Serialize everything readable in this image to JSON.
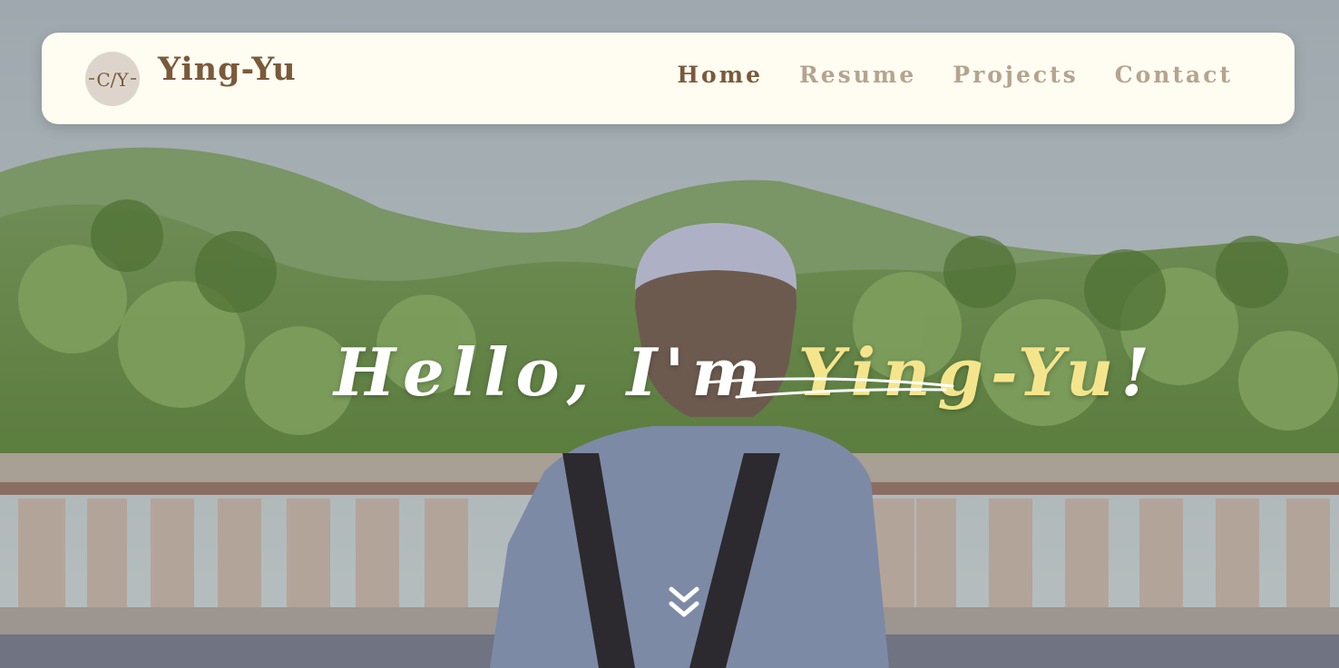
{
  "brand": {
    "logo_text": "C/Y",
    "name": "Ying-Yu"
  },
  "nav": {
    "items": [
      {
        "label": "Home",
        "active": true
      },
      {
        "label": "Resume",
        "active": false
      },
      {
        "label": "Projects",
        "active": false
      },
      {
        "label": "Contact",
        "active": false
      }
    ]
  },
  "hero": {
    "greeting_prefix": "Hello, I'm ",
    "greeting_name": "Ying-Yu",
    "greeting_suffix": "!",
    "scroll_icon": "double-chevron-down-icon"
  },
  "colors": {
    "navbar_bg": "#fffcf2",
    "brand": "#7a5a3b",
    "nav_inactive": "#b5a48f",
    "name_highlight": "#f4e58c"
  }
}
